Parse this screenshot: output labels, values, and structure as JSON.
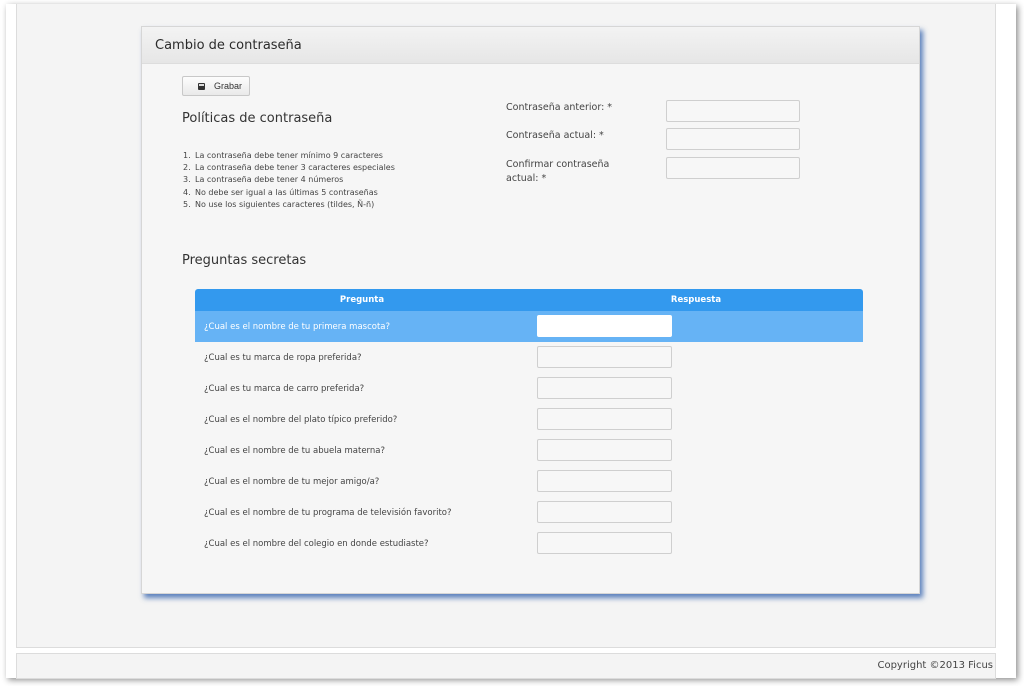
{
  "panel": {
    "title": "Cambio de contraseña",
    "save_label": "Grabar"
  },
  "policies": {
    "title": "Políticas de contraseña",
    "items": [
      {
        "num": "1.",
        "text": "La contraseña debe tener mínimo 9 caracteres"
      },
      {
        "num": "2.",
        "text": "La contraseña debe tener 3 caracteres especiales"
      },
      {
        "num": "3.",
        "text": "La contraseña debe tener 4 números"
      },
      {
        "num": "4.",
        "text": "No debe ser igual a las últimas 5 contraseñas"
      },
      {
        "num": "5.",
        "text": "No use los siguientes caracteres (tildes, Ñ-ñ)"
      }
    ]
  },
  "password_form": {
    "previous_label": "Contraseña anterior: *",
    "previous_value": "",
    "current_label": "Contraseña actual: *",
    "current_value": "",
    "confirm_label_line1": "Confirmar contraseña",
    "confirm_label_line2": "actual: *",
    "confirm_value": ""
  },
  "secret_questions": {
    "title": "Preguntas secretas",
    "columns": {
      "question": "Pregunta",
      "answer": "Respuesta"
    },
    "rows": [
      {
        "question": "¿Cual es el nombre de tu primera mascota?",
        "answer": "",
        "selected": true
      },
      {
        "question": "¿Cual es tu marca de ropa preferida?",
        "answer": "",
        "selected": false
      },
      {
        "question": "¿Cual es tu marca de carro preferida?",
        "answer": "",
        "selected": false
      },
      {
        "question": "¿Cual es el nombre del plato típico preferido?",
        "answer": "",
        "selected": false
      },
      {
        "question": "¿Cual es el nombre de tu abuela materna?",
        "answer": "",
        "selected": false
      },
      {
        "question": "¿Cual es el nombre de tu mejor amigo/a?",
        "answer": "",
        "selected": false
      },
      {
        "question": "¿Cual es el nombre de tu programa de televisión favorito?",
        "answer": "",
        "selected": false
      },
      {
        "question": "¿Cual es el nombre del colegio en donde estudiaste?",
        "answer": "",
        "selected": false
      }
    ]
  },
  "footer": {
    "copyright": "Copyright ©2013 Ficus"
  },
  "colors": {
    "header_blue": "#3399ee",
    "selected_row_blue": "#66b3f5",
    "panel_shadow": "#285aaa"
  },
  "icons": {
    "save": "floppy-disk-icon"
  }
}
